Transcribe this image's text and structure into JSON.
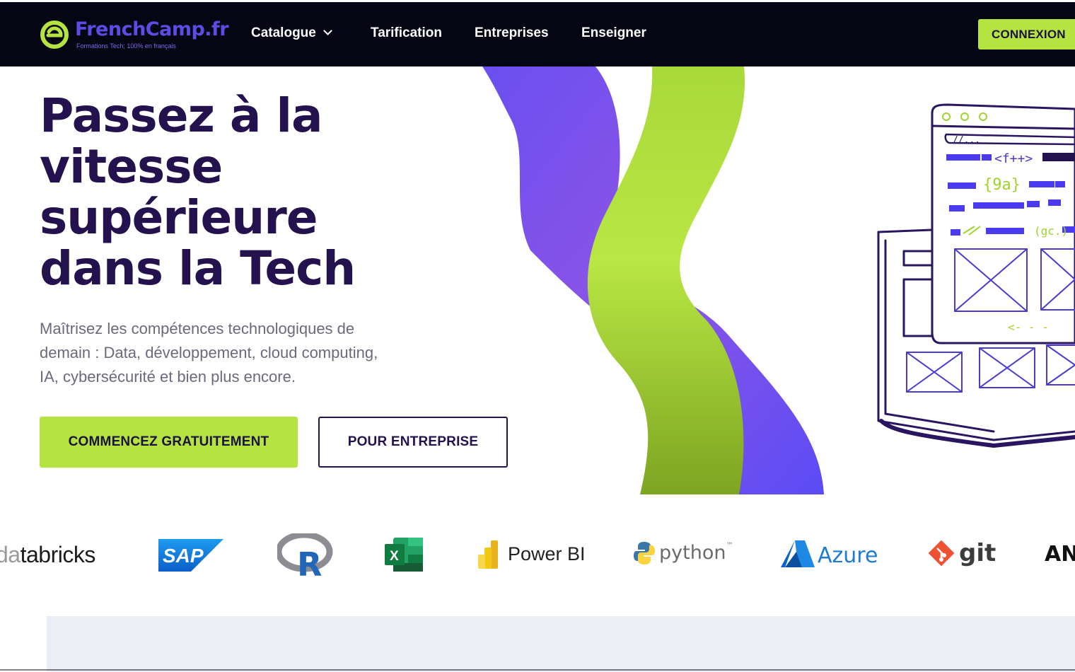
{
  "brand": {
    "name": "FrenchCamp.fr",
    "tagline": "Formations Tech; 100% en français",
    "colors": {
      "primary": "#5b4ce6",
      "accent": "#b5e33f",
      "dark": "#050614",
      "heading": "#23124e"
    }
  },
  "nav": {
    "items": [
      {
        "label": "Catalogue",
        "has_dropdown": true
      },
      {
        "label": "Tarification"
      },
      {
        "label": "Entreprises"
      },
      {
        "label": "Enseigner"
      }
    ],
    "login_label": "CONNEXION"
  },
  "hero": {
    "title_lines": [
      "Passez à la",
      "vitesse",
      "supérieure",
      "dans la Tech"
    ],
    "subtitle_lines": [
      "Maîtrisez les compétences technologiques de",
      "demain : Data, développement, cloud computing,",
      "IA, cybersécurité et bien plus encore."
    ],
    "primary_cta": "COMMENCEZ GRATUITEMENT",
    "secondary_cta": "POUR ENTREPRISE"
  },
  "illustration": {
    "code_snippets": [
      "//...",
      "<f++>",
      "{9a}",
      "(gc.)",
      "<- - -"
    ]
  },
  "logos": {
    "databricks_dim": "da",
    "databricks_rest": "tabricks",
    "sap": "SAP",
    "r": "R",
    "excel": "X",
    "powerbi": "Power BI",
    "python": "python",
    "python_tm": "™",
    "azure": "Azure",
    "git": "git",
    "an": "AN"
  }
}
